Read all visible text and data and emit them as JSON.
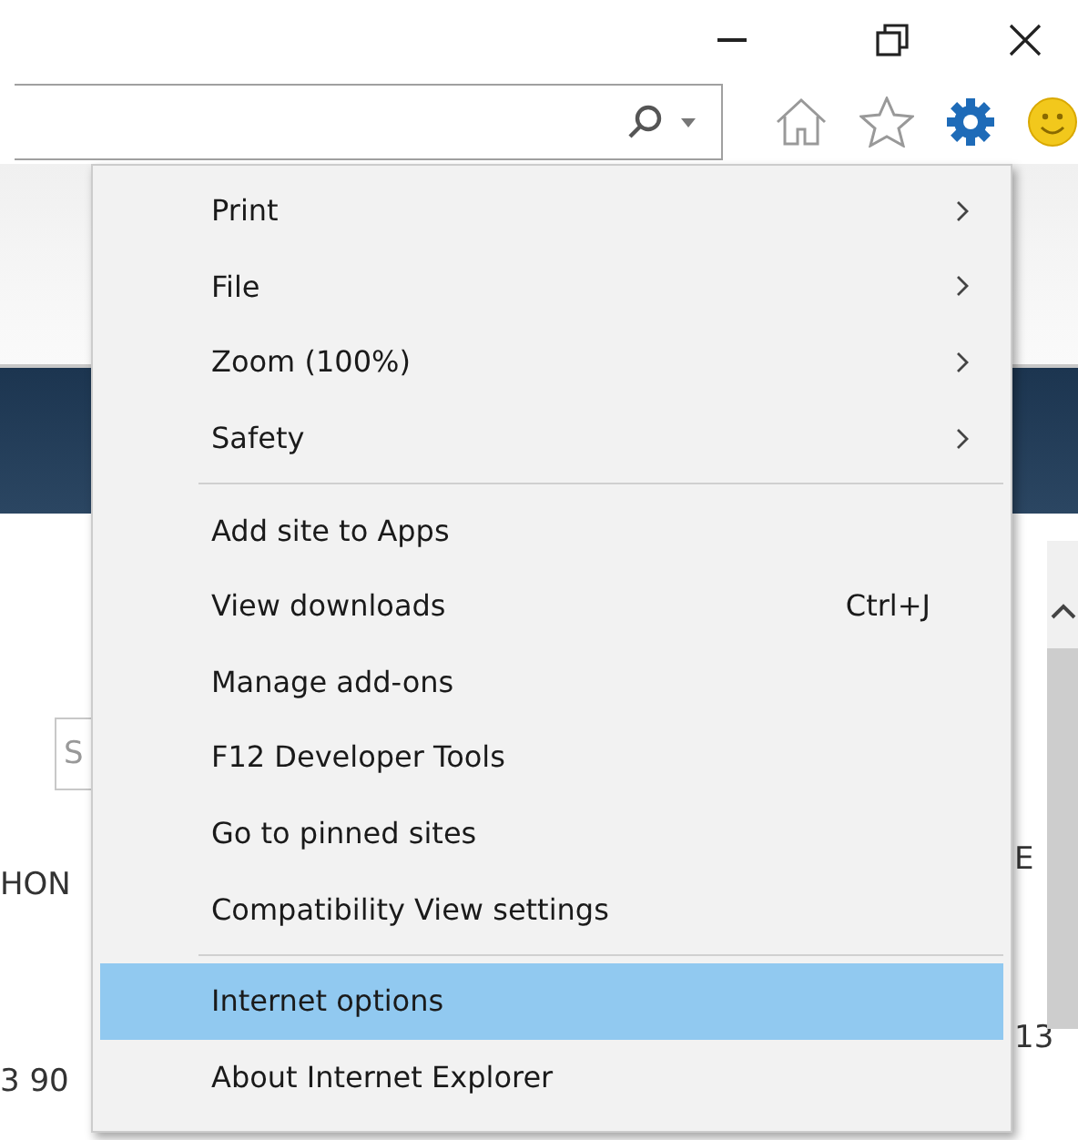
{
  "menu": {
    "sections": [
      [
        {
          "label": "Print",
          "submenu": true,
          "selected": false
        },
        {
          "label": "File",
          "submenu": true,
          "selected": false
        },
        {
          "label": "Zoom (100%)",
          "submenu": true,
          "selected": false
        },
        {
          "label": "Safety",
          "submenu": true,
          "selected": false
        }
      ],
      [
        {
          "label": "Add site to Apps",
          "submenu": false,
          "selected": false
        },
        {
          "label": "View downloads",
          "shortcut": "Ctrl+J",
          "submenu": false,
          "selected": false
        },
        {
          "label": "Manage add-ons",
          "submenu": false,
          "selected": false
        },
        {
          "label": "F12 Developer Tools",
          "submenu": false,
          "selected": false
        },
        {
          "label": "Go to pinned sites",
          "submenu": false,
          "selected": false
        },
        {
          "label": "Compatibility View settings",
          "submenu": false,
          "selected": false
        }
      ],
      [
        {
          "label": "Internet options",
          "submenu": false,
          "selected": true
        },
        {
          "label": "About Internet Explorer",
          "submenu": false,
          "selected": false
        }
      ]
    ]
  },
  "page": {
    "search_box": {
      "placeholder": "S"
    },
    "left_texts": [
      "HON",
      "3 90"
    ],
    "right_texts": [
      "E",
      "13"
    ]
  }
}
